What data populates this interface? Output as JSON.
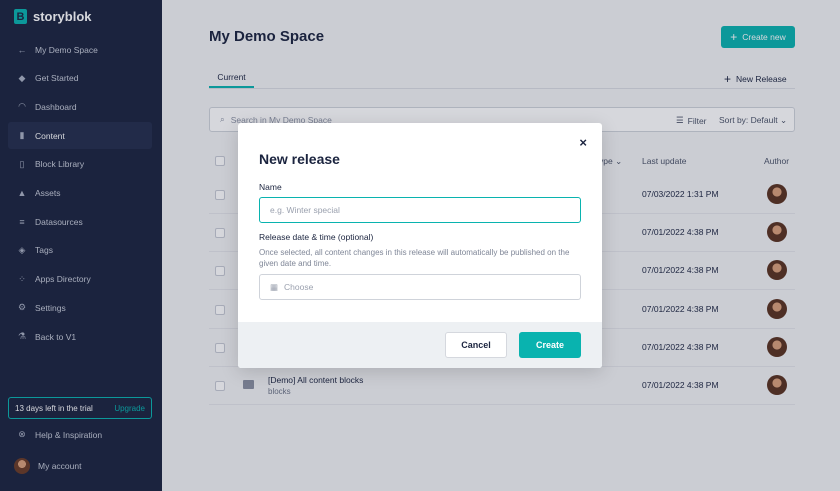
{
  "brand": {
    "name": "storyblok",
    "logo_letter": "B"
  },
  "sidebar": {
    "items": [
      {
        "label": "My Demo Space",
        "icon": "arrow-left-icon",
        "glyph": "←"
      },
      {
        "label": "Get Started",
        "icon": "rocket-icon",
        "glyph": "◆"
      },
      {
        "label": "Dashboard",
        "icon": "gauge-icon",
        "glyph": "◠"
      },
      {
        "label": "Content",
        "icon": "content-icon",
        "glyph": "▮"
      },
      {
        "label": "Block Library",
        "icon": "block-library-icon",
        "glyph": "▯"
      },
      {
        "label": "Assets",
        "icon": "assets-icon",
        "glyph": "▲"
      },
      {
        "label": "Datasources",
        "icon": "datasources-icon",
        "glyph": "≡"
      },
      {
        "label": "Tags",
        "icon": "tag-icon",
        "glyph": "◈"
      },
      {
        "label": "Apps Directory",
        "icon": "apps-icon",
        "glyph": "⁘"
      },
      {
        "label": "Settings",
        "icon": "gear-icon",
        "glyph": "⚙"
      },
      {
        "label": "Back to V1",
        "icon": "flask-icon",
        "glyph": "⚗"
      }
    ],
    "active_index": 3,
    "trial": {
      "text": "13 days left in the trial",
      "upgrade": "Upgrade"
    },
    "help": {
      "label": "Help & Inspiration",
      "glyph": "⊗"
    },
    "account": {
      "label": "My account"
    }
  },
  "main": {
    "title": "My Demo Space",
    "create_new": "Create new",
    "tab_current": "Current",
    "new_release": "New Release",
    "search_placeholder": "Search in My Demo Space",
    "filter": "Filter",
    "sort_by": "Sort by: Default",
    "columns": {
      "type": "ype",
      "last_update": "Last update",
      "author": "Author"
    },
    "rows": [
      {
        "name": "",
        "sub": "",
        "date": "07/03/2022 1:31 PM"
      },
      {
        "name": "",
        "sub": "",
        "date": "07/01/2022 4:38 PM"
      },
      {
        "name": "",
        "sub": "",
        "date": "07/01/2022 4:38 PM"
      },
      {
        "name": "",
        "sub": "",
        "date": "07/01/2022 4:38 PM"
      },
      {
        "name": "",
        "sub": "",
        "date": "07/01/2022 4:38 PM"
      },
      {
        "name": "[Demo] All content blocks",
        "sub": "blocks",
        "date": "07/01/2022 4:38 PM"
      }
    ]
  },
  "modal": {
    "title": "New release",
    "close": "×",
    "name_label": "Name",
    "name_placeholder": "e.g. Winter special",
    "name_value": "",
    "date_label": "Release date & time (optional)",
    "date_help": "Once selected, all content changes in this release will automatically be published on the given date and time.",
    "date_placeholder": "Choose",
    "cancel": "Cancel",
    "create": "Create"
  },
  "colors": {
    "accent": "#09b3af",
    "sidebar_bg": "#1b243f",
    "text_dark": "#1b243f"
  }
}
